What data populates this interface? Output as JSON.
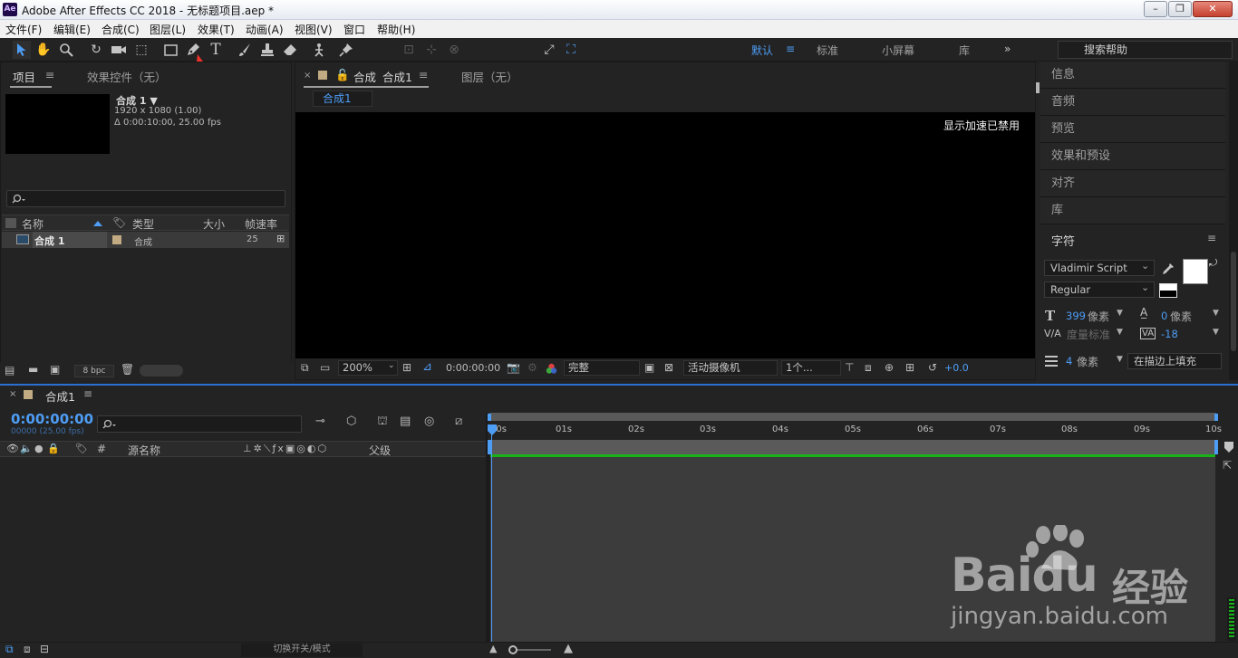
{
  "window": {
    "title": "Adobe After Effects CC 2018 - 无标题项目.aep *",
    "logo": "Ae",
    "buttons": {
      "min": "–",
      "max": "❐",
      "close": "✕"
    }
  },
  "menu": [
    "文件(F)",
    "编辑(E)",
    "合成(C)",
    "图层(L)",
    "效果(T)",
    "动画(A)",
    "视图(V)",
    "窗口",
    "帮助(H)"
  ],
  "toolbar": {
    "align_label": "对齐",
    "workspaces": [
      "默认",
      "标准",
      "小屏幕",
      "库"
    ],
    "search_placeholder": "搜索帮助"
  },
  "project_panel": {
    "tab_project": "项目",
    "tab_effects": "效果控件（无）",
    "comp_name": "合成 1 ▼",
    "comp_res": "1920 x 1080 (1.00)",
    "comp_duration": "Δ 0:00:10:00, 25.00 fps",
    "columns": {
      "name": "名称",
      "type": "类型",
      "size": "大小",
      "fps": "帧速率"
    },
    "items": [
      {
        "name": "合成 1",
        "type": "合成",
        "fps": "25"
      }
    ],
    "bpc": "8 bpc"
  },
  "composition_panel": {
    "tab_label": "合成",
    "tab_comp": "合成1",
    "tab_layer": "图层（无）",
    "breadcrumb": "合成1",
    "notice": "显示加速已禁用",
    "zoom": "200%",
    "timecode": "0:00:00:00",
    "resolution": "完整",
    "camera": "活动摄像机",
    "views": "1个...",
    "exposure": "+0.0"
  },
  "right_panels": [
    "信息",
    "音频",
    "预览",
    "效果和预设",
    "对齐",
    "库"
  ],
  "character_panel": {
    "title": "字符",
    "font": "Vladimir Script",
    "style": "Regular",
    "size_value": "399",
    "size_unit": "像素",
    "leading_value": "0",
    "leading_unit": "像素",
    "kerning": "度量标准",
    "tracking": "-18",
    "stroke_value": "4",
    "stroke_unit": "像素",
    "stroke_mode": "在描边上填充"
  },
  "timeline": {
    "tab": "合成1",
    "timecode": "0:00:00:00",
    "frames": "00000 (25.00 fps)",
    "columns": {
      "hash": "#",
      "source": "源名称",
      "parent": "父级"
    },
    "ruler_ticks": [
      "00s",
      "01s",
      "02s",
      "03s",
      "04s",
      "05s",
      "06s",
      "07s",
      "08s",
      "09s",
      "10s"
    ],
    "toggle_label": "切换开关/模式"
  },
  "watermark": {
    "brand": "Baidu",
    "brand_cn": "经验",
    "url": "jingyan.baidu.com"
  },
  "colors": {
    "accent": "#4e9df5",
    "panel": "#232323",
    "timeline_border": "#2d6fd0",
    "work_area": "#19b319",
    "arrow": "#e8322a"
  }
}
